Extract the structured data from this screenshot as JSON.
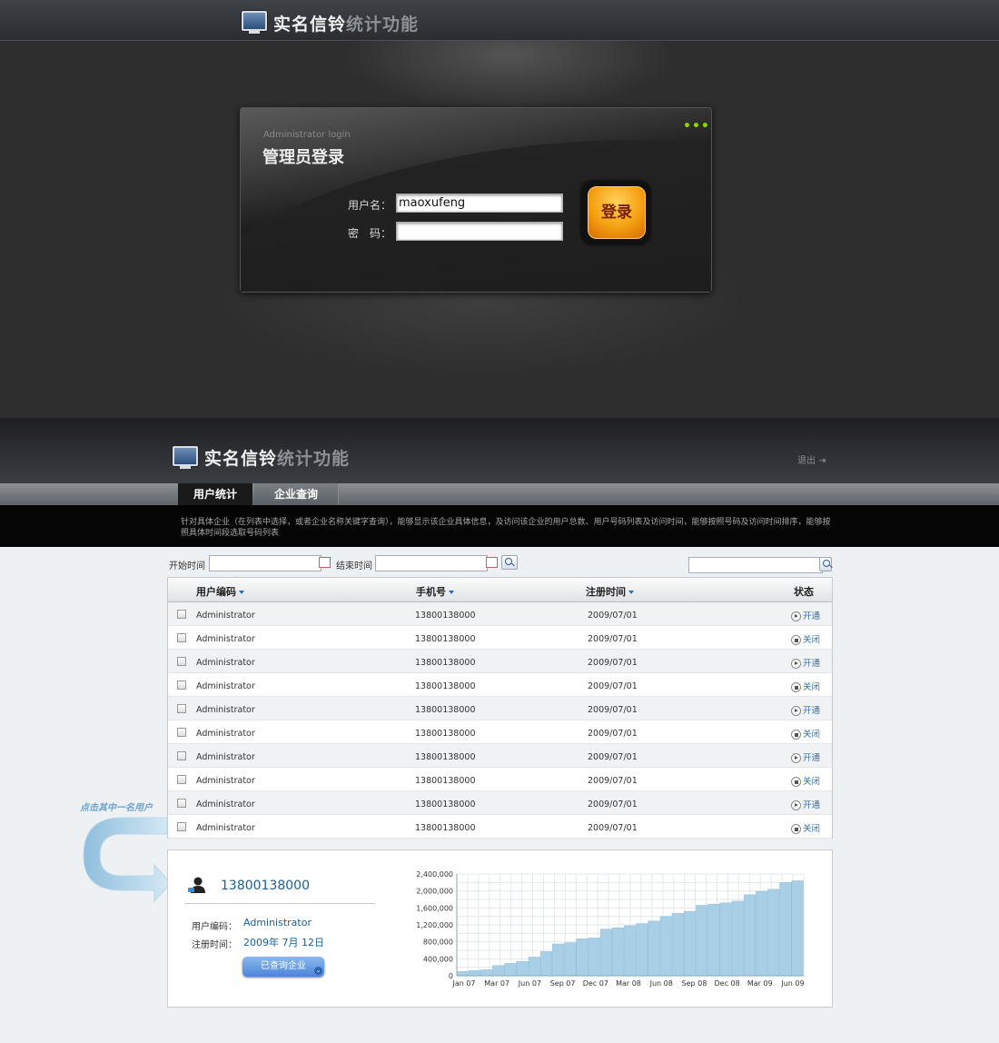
{
  "login": {
    "app_title_bright": "实名信铃",
    "app_title_dim": "统计功能",
    "panel_subtitle": "Administrator login",
    "panel_title": "管理员登录",
    "username_label": "用户名：",
    "password_label": "密　码：",
    "username_value": "maoxufeng",
    "password_value": "",
    "login_button": "登录",
    "dots": "•••"
  },
  "stats": {
    "app_title_bright": "实名信铃",
    "app_title_dim": "统计功能",
    "logout": "退出 ⇥",
    "tabs": [
      {
        "label": "用户统计",
        "active": true
      },
      {
        "label": "企业查询",
        "active": false
      }
    ],
    "description": "针对具体企业（在列表中选择，或者企业名称关键字查询），能够显示该企业具体信息，及访问该企业的用户总数、用户号码列表及访问时间，能够按照号码及访问时间排序，能够按照具体时间段选取号码列表"
  },
  "filter": {
    "start_label": "开始时间",
    "end_label": "结束时间",
    "start_value": "",
    "end_value": "",
    "search_value": ""
  },
  "table": {
    "headers": [
      "用户编码",
      "手机号",
      "注册时间",
      "状态"
    ],
    "rows": [
      {
        "code": "Administrator",
        "phone": "13800138000",
        "date": "2009/07/01",
        "status": "开通"
      },
      {
        "code": "Administrator",
        "phone": "13800138000",
        "date": "2009/07/01",
        "status": "关闭"
      },
      {
        "code": "Administrator",
        "phone": "13800138000",
        "date": "2009/07/01",
        "status": "开通"
      },
      {
        "code": "Administrator",
        "phone": "13800138000",
        "date": "2009/07/01",
        "status": "关闭"
      },
      {
        "code": "Administrator",
        "phone": "13800138000",
        "date": "2009/07/01",
        "status": "开通"
      },
      {
        "code": "Administrator",
        "phone": "13800138000",
        "date": "2009/07/01",
        "status": "关闭"
      },
      {
        "code": "Administrator",
        "phone": "13800138000",
        "date": "2009/07/01",
        "status": "开通"
      },
      {
        "code": "Administrator",
        "phone": "13800138000",
        "date": "2009/07/01",
        "status": "关闭"
      },
      {
        "code": "Administrator",
        "phone": "13800138000",
        "date": "2009/07/01",
        "status": "开通"
      },
      {
        "code": "Administrator",
        "phone": "13800138000",
        "date": "2009/07/01",
        "status": "关闭"
      }
    ]
  },
  "annotation": {
    "text": "点击其中一名用户"
  },
  "detail": {
    "phone": "13800138000",
    "code_label": "用户编码：",
    "code_value": "Administrator",
    "date_label": "注册时间：",
    "date_value": "2009年 7月 12日",
    "button": "已查询企业"
  },
  "colors": {
    "accent": "#1a5e96",
    "link": "#3a6fb0",
    "bar_fill": "#a9cfe6",
    "login_orange": "#f5a012"
  },
  "chart_data": {
    "type": "bar",
    "title": "",
    "xlabel": "",
    "ylabel": "",
    "ylim": [
      0,
      2400000
    ],
    "y_ticks": [
      "0",
      "400,000",
      "800,000",
      "1,200,000",
      "1,600,000",
      "2,000,000",
      "2,400,000"
    ],
    "x_tick_labels": [
      "Jan 07",
      "Mar 07",
      "Jun 07",
      "Sep 07",
      "Dec 07",
      "Mar 08",
      "Jun 08",
      "Sep 08",
      "Dec 08",
      "Mar 09",
      "Jun 09"
    ],
    "grid": true,
    "values": [
      100000,
      120000,
      140000,
      240000,
      290000,
      340000,
      440000,
      570000,
      750000,
      780000,
      870000,
      890000,
      1100000,
      1130000,
      1180000,
      1230000,
      1290000,
      1400000,
      1470000,
      1520000,
      1660000,
      1690000,
      1720000,
      1760000,
      1910000,
      1990000,
      2040000,
      2200000,
      2240000
    ]
  }
}
